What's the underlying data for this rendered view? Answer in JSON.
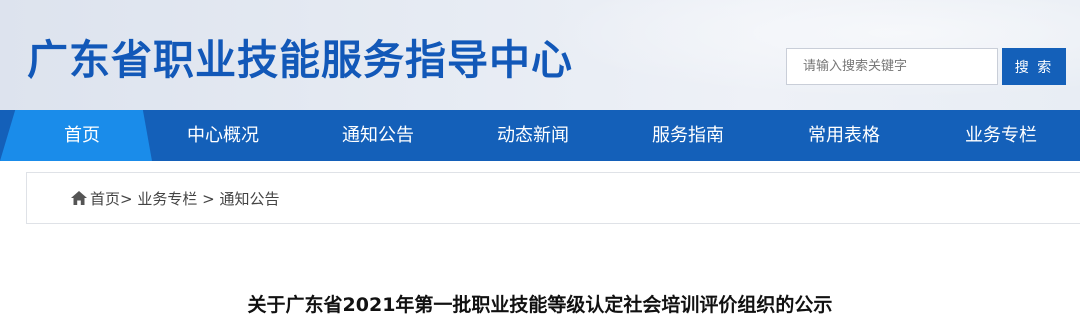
{
  "header": {
    "site_title": "广东省职业技能服务指导中心",
    "search": {
      "placeholder": "请输入搜索关键字",
      "value": "",
      "button_label": "搜 索"
    }
  },
  "nav": {
    "active_index": 0,
    "items": [
      {
        "label": "首页"
      },
      {
        "label": "中心概况"
      },
      {
        "label": "通知公告"
      },
      {
        "label": "动态新闻"
      },
      {
        "label": "服务指南"
      },
      {
        "label": "常用表格"
      },
      {
        "label": "业务专栏"
      }
    ]
  },
  "breadcrumb": {
    "home": "首页",
    "items": [
      "业务专栏",
      "通知公告"
    ],
    "separator": ">"
  },
  "article": {
    "title": "关于广东省2021年第一批职业技能等级认定社会培训评价组织的公示"
  },
  "colors": {
    "brand_blue": "#1460b9",
    "active_nav": "#1a8cea",
    "title_blue": "#1258b8"
  }
}
